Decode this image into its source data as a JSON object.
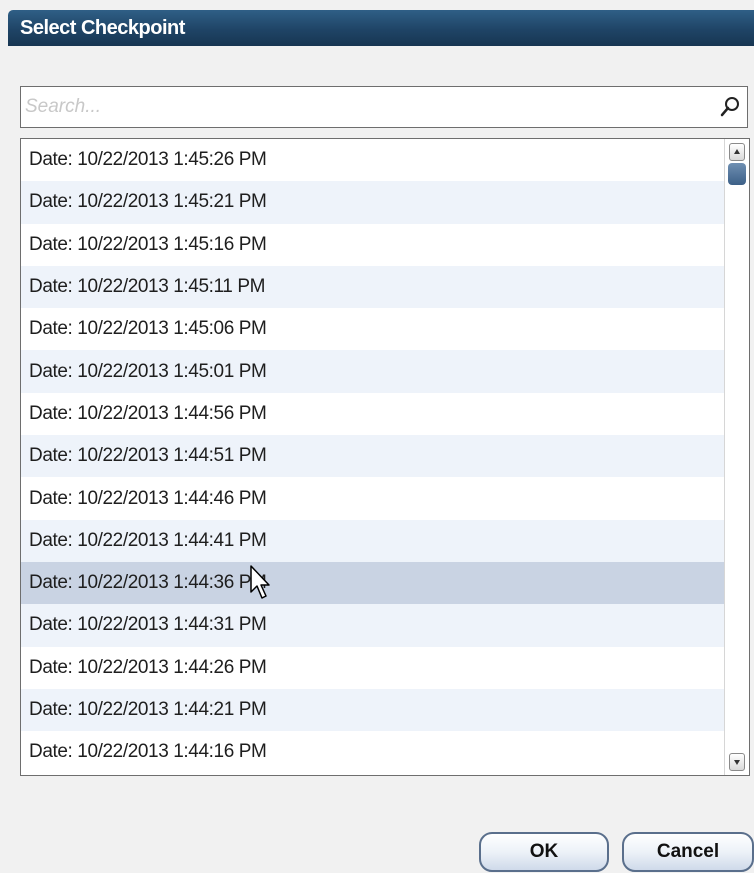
{
  "dialog": {
    "title": "Select Checkpoint"
  },
  "search": {
    "placeholder": "Search...",
    "value": ""
  },
  "checkpoints": [
    "Date: 10/22/2013 1:45:26 PM",
    "Date: 10/22/2013 1:45:21 PM",
    "Date: 10/22/2013 1:45:16 PM",
    "Date: 10/22/2013 1:45:11 PM",
    "Date: 10/22/2013 1:45:06 PM",
    "Date: 10/22/2013 1:45:01 PM",
    "Date: 10/22/2013 1:44:56 PM",
    "Date: 10/22/2013 1:44:51 PM",
    "Date: 10/22/2013 1:44:46 PM",
    "Date: 10/22/2013 1:44:41 PM",
    "Date: 10/22/2013 1:44:36 PM",
    "Date: 10/22/2013 1:44:31 PM",
    "Date: 10/22/2013 1:44:26 PM",
    "Date: 10/22/2013 1:44:21 PM",
    "Date: 10/22/2013 1:44:16 PM"
  ],
  "hovered_index": 10,
  "buttons": {
    "ok": "OK",
    "cancel": "Cancel"
  },
  "colors": {
    "title_bar": "#1f4466",
    "row_alt": "#eef3fa",
    "row_hover": "#c9d3e3",
    "scroll_thumb": "#3c6087"
  },
  "icons": {
    "search": "magnifier-icon",
    "scroll_up": "arrow-up-icon",
    "scroll_down": "arrow-down-icon",
    "pointer": "mouse-cursor-icon"
  }
}
